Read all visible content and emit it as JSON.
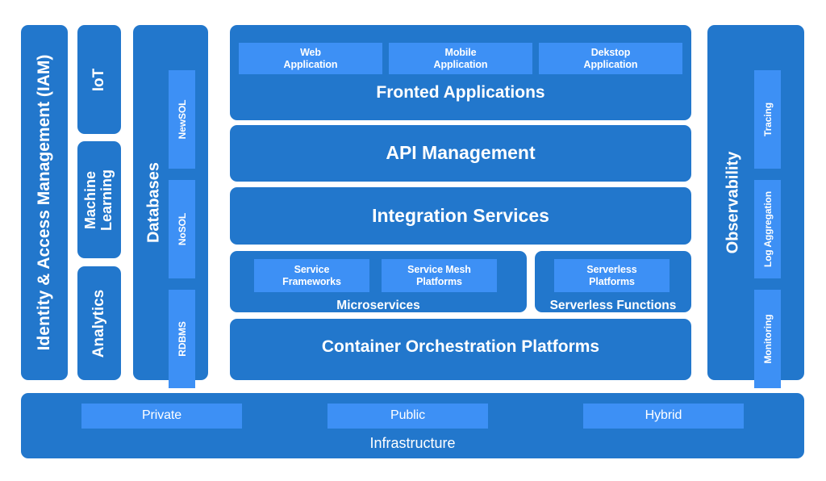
{
  "colors": {
    "background": "#ffffff",
    "container_blue": "#2277cc",
    "chip_blue": "#3d90f5",
    "text": "#ffffff"
  },
  "identity": {
    "label": "Identity & Access Management (IAM)"
  },
  "capabilities": {
    "items": [
      {
        "label": "IoT"
      },
      {
        "label": "Machine Learning"
      },
      {
        "label": "Analytics"
      }
    ]
  },
  "databases": {
    "label": "Databases",
    "items": [
      {
        "label": "NewSOL"
      },
      {
        "label": "NoSOL"
      },
      {
        "label": "RDBMS"
      }
    ]
  },
  "frontend": {
    "label": "Fronted Applications",
    "items": [
      {
        "label": "Web\nApplication"
      },
      {
        "label": "Mobile\nApplication"
      },
      {
        "label": "Dekstop\nApplication"
      }
    ]
  },
  "api_management": {
    "label": "API Management"
  },
  "integration": {
    "label": "Integration Services"
  },
  "microservices": {
    "label": "Microservices",
    "items": [
      {
        "label": "Service\nFrameworks"
      },
      {
        "label": "Service Mesh\nPlatforms"
      }
    ]
  },
  "serverless": {
    "label": "Serverless Functions",
    "items": [
      {
        "label": "Serverless\nPlatforms"
      }
    ]
  },
  "container_orchestration": {
    "label": "Container Orchestration Platforms"
  },
  "observability": {
    "label": "Observability",
    "items": [
      {
        "label": "Tracing"
      },
      {
        "label": "Log Aggregation"
      },
      {
        "label": "Monitoring"
      }
    ]
  },
  "infrastructure": {
    "label": "Infrastructure",
    "items": [
      {
        "label": "Private"
      },
      {
        "label": "Public"
      },
      {
        "label": "Hybrid"
      }
    ]
  }
}
